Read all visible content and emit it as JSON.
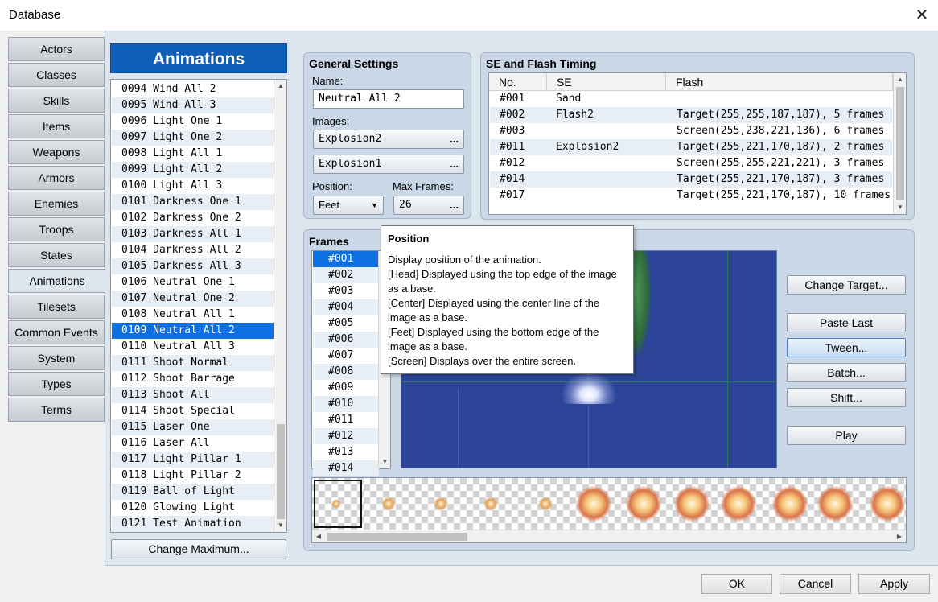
{
  "window": {
    "title": "Database",
    "close_glyph": "✕"
  },
  "tabs": [
    "Actors",
    "Classes",
    "Skills",
    "Items",
    "Weapons",
    "Armors",
    "Enemies",
    "Troops",
    "States",
    "Animations",
    "Tilesets",
    "Common Events",
    "System",
    "Types",
    "Terms"
  ],
  "active_tab": "Animations",
  "list": {
    "header": "Animations",
    "items": [
      "0094 Wind All 2",
      "0095 Wind All 3",
      "0096 Light One 1",
      "0097 Light One 2",
      "0098 Light All 1",
      "0099 Light All 2",
      "0100 Light All 3",
      "0101 Darkness One 1",
      "0102 Darkness One 2",
      "0103 Darkness All 1",
      "0104 Darkness All 2",
      "0105 Darkness All 3",
      "0106 Neutral One 1",
      "0107 Neutral One 2",
      "0108 Neutral All 1",
      "0109 Neutral All 2",
      "0110 Neutral All 3",
      "0111 Shoot Normal",
      "0112 Shoot Barrage",
      "0113 Shoot All",
      "0114 Shoot Special",
      "0115 Laser One",
      "0116 Laser All",
      "0117 Light Pillar 1",
      "0118 Light Pillar 2",
      "0119 Ball of Light",
      "0120 Glowing Light",
      "0121 Test Animation"
    ],
    "selected_index": 15,
    "change_maximum": "Change Maximum..."
  },
  "general": {
    "title": "General Settings",
    "name_label": "Name:",
    "name_value": "Neutral All 2",
    "images_label": "Images:",
    "image1": "Explosion2",
    "image2": "Explosion1",
    "dots": "...",
    "position_label": "Position:",
    "position_value": "Feet",
    "max_frames_label": "Max Frames:",
    "max_frames_value": "26"
  },
  "se_timing": {
    "title": "SE and Flash Timing",
    "columns": [
      "No.",
      "SE",
      "Flash"
    ],
    "rows": [
      {
        "no": "#001",
        "se": "Sand",
        "flash": ""
      },
      {
        "no": "#002",
        "se": "Flash2",
        "flash": "Target(255,255,187,187), 5 frames"
      },
      {
        "no": "#003",
        "se": "",
        "flash": "Screen(255,238,221,136), 6 frames"
      },
      {
        "no": "#011",
        "se": "Explosion2",
        "flash": "Target(255,221,170,187), 2 frames"
      },
      {
        "no": "#012",
        "se": "",
        "flash": "Screen(255,255,221,221), 3 frames"
      },
      {
        "no": "#014",
        "se": "",
        "flash": "Target(255,221,170,187), 3 frames"
      },
      {
        "no": "#017",
        "se": "",
        "flash": "Target(255,221,170,187), 10 frames"
      }
    ]
  },
  "frames": {
    "title": "Frames",
    "items": [
      "#001",
      "#002",
      "#003",
      "#004",
      "#005",
      "#006",
      "#007",
      "#008",
      "#009",
      "#010",
      "#011",
      "#012",
      "#013",
      "#014"
    ],
    "selected_index": 0
  },
  "actions": {
    "change_target": "Change Target...",
    "paste_last": "Paste Last",
    "tween": "Tween...",
    "batch": "Batch...",
    "shift": "Shift...",
    "play": "Play"
  },
  "tooltip": {
    "title": "Position",
    "lines": [
      "Display position of the animation.",
      "[Head] Displayed using the top edge of the image",
      "as a base.",
      "[Center] Displayed using the center line of the",
      "image as a base.",
      "[Feet] Displayed using the bottom edge of the",
      "image as a base.",
      "[Screen] Displays over the entire screen."
    ]
  },
  "footer": {
    "ok": "OK",
    "cancel": "Cancel",
    "apply": "Apply"
  }
}
